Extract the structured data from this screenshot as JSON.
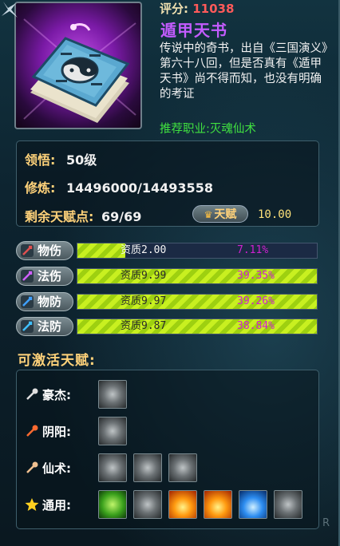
{
  "score": {
    "label": "评分:",
    "value": "11038"
  },
  "item": {
    "name": "遁甲天书",
    "description": "传说中的奇书，出自《三国演义》第六十八回，但是否真有《遁甲天书》尚不得而知，也没有明确的考证",
    "recommend": "推荐职业:灭魂仙术"
  },
  "stats": {
    "comprehension": {
      "label": "领悟:",
      "value": "50级"
    },
    "cultivation": {
      "label": "修炼:",
      "value": "14496000/14493558"
    },
    "talent_points": {
      "label": "剩余天赋点:",
      "value": "69/69"
    },
    "talent_button": "天赋",
    "talent_number": "10.00"
  },
  "bars": [
    {
      "label": "物伤",
      "quality": "资质2.00",
      "percent": "7.11%",
      "fill": 0.2,
      "icon": "sword-icon",
      "color": "#e05050"
    },
    {
      "label": "法伤",
      "quality": "资质9.99",
      "percent": "39.35%",
      "fill": 1.0,
      "icon": "magic-bolt-icon",
      "color": "#d060ff"
    },
    {
      "label": "物防",
      "quality": "资质9.97",
      "percent": "39.26%",
      "fill": 1.0,
      "icon": "shield-icon",
      "color": "#40a0ff"
    },
    {
      "label": "法防",
      "quality": "资质9.87",
      "percent": "38.84%",
      "fill": 1.0,
      "icon": "magic-shield-icon",
      "color": "#40c0ff"
    }
  ],
  "activatable": {
    "title": "可激活天赋:",
    "rows": [
      {
        "label": "豪杰:",
        "icon": "axe-icon",
        "skills": [
          "gray"
        ]
      },
      {
        "label": "阴阳:",
        "icon": "staff-icon",
        "skills": [
          "gray"
        ]
      },
      {
        "label": "仙术:",
        "icon": "hand-icon",
        "skills": [
          "gray",
          "gray",
          "gray"
        ]
      },
      {
        "label": "通用:",
        "icon": "star-icon",
        "skills": [
          "green",
          "gray",
          "fire",
          "fire",
          "blue",
          "gray"
        ]
      }
    ]
  },
  "corner_mark": "R"
}
